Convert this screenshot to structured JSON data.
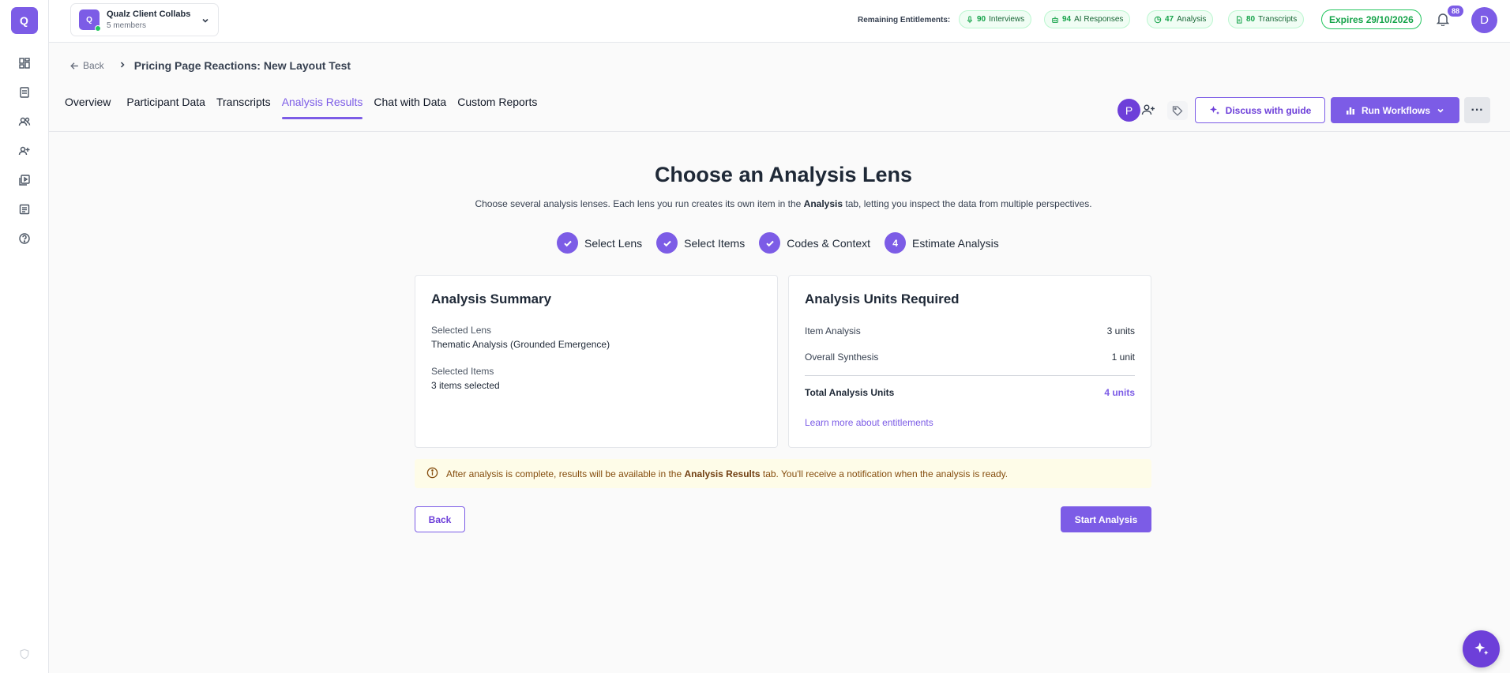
{
  "sidebar": {
    "logo": "Q",
    "items": [
      {
        "icon": "dashboard-icon"
      },
      {
        "icon": "document-icon"
      },
      {
        "icon": "users-icon"
      },
      {
        "icon": "add-user-icon"
      },
      {
        "icon": "media-library-icon"
      },
      {
        "icon": "notes-icon"
      },
      {
        "icon": "help-icon"
      }
    ]
  },
  "workspace": {
    "avatar": "Q",
    "name": "Qualz Client Collabs",
    "members": "5 members"
  },
  "entitlements": {
    "label": "Remaining Entitlements:",
    "items": [
      {
        "count": "90",
        "label": "Interviews",
        "icon": "microphone-icon"
      },
      {
        "count": "94",
        "label": "AI Responses",
        "icon": "robot-icon"
      },
      {
        "count": "47",
        "label": "Analysis",
        "icon": "pie-chart-icon"
      },
      {
        "count": "80",
        "label": "Transcripts",
        "icon": "file-icon"
      }
    ],
    "expires": "Expires 29/10/2026"
  },
  "notifications": {
    "count": "88"
  },
  "user": {
    "initial": "D"
  },
  "breadcrumb": {
    "back": "Back",
    "title": "Pricing Page Reactions: New Layout Test"
  },
  "tabs": [
    {
      "label": "Overview",
      "active": false
    },
    {
      "label": "Participant Data",
      "active": false
    },
    {
      "label": "Transcripts",
      "active": false
    },
    {
      "label": "Analysis Results",
      "active": true
    },
    {
      "label": "Chat with Data",
      "active": false
    },
    {
      "label": "Custom Reports",
      "active": false
    }
  ],
  "toolbar": {
    "participant_initial": "P",
    "discuss_label": "Discuss with guide",
    "run_label": "Run Workflows",
    "more_label": "···"
  },
  "main": {
    "title": "Choose an Analysis Lens",
    "subtitle_pre": "Choose several analysis lenses. Each lens you run creates its own item in the ",
    "subtitle_bold": "Analysis",
    "subtitle_post": " tab, letting you inspect the data from multiple perspectives.",
    "steps": [
      {
        "label": "Select Lens",
        "done": true,
        "num": "1"
      },
      {
        "label": "Select Items",
        "done": true,
        "num": "2"
      },
      {
        "label": "Codes & Context",
        "done": true,
        "num": "3"
      },
      {
        "label": "Estimate Analysis",
        "done": false,
        "num": "4"
      }
    ]
  },
  "summary": {
    "title": "Analysis Summary",
    "lens_label": "Selected Lens",
    "lens_value": "Thematic Analysis (Grounded Emergence)",
    "items_label": "Selected Items",
    "items_value": "3 items selected"
  },
  "units": {
    "title": "Analysis Units Required",
    "rows": [
      {
        "label": "Item Analysis",
        "value": "3 units"
      },
      {
        "label": "Overall Synthesis",
        "value": "1 unit"
      }
    ],
    "total_label": "Total Analysis Units",
    "total_value": "4 units",
    "learn_more": "Learn more about entitlements"
  },
  "notice": {
    "pre": "After analysis is complete, results will be available in the ",
    "bold": "Analysis Results",
    "post": " tab. You'll receive a notification when the analysis is ready."
  },
  "actions": {
    "back": "Back",
    "start": "Start Analysis"
  },
  "colors": {
    "accent": "#7c5ce6",
    "success": "#16a34a",
    "notice_bg": "#fefce8"
  }
}
